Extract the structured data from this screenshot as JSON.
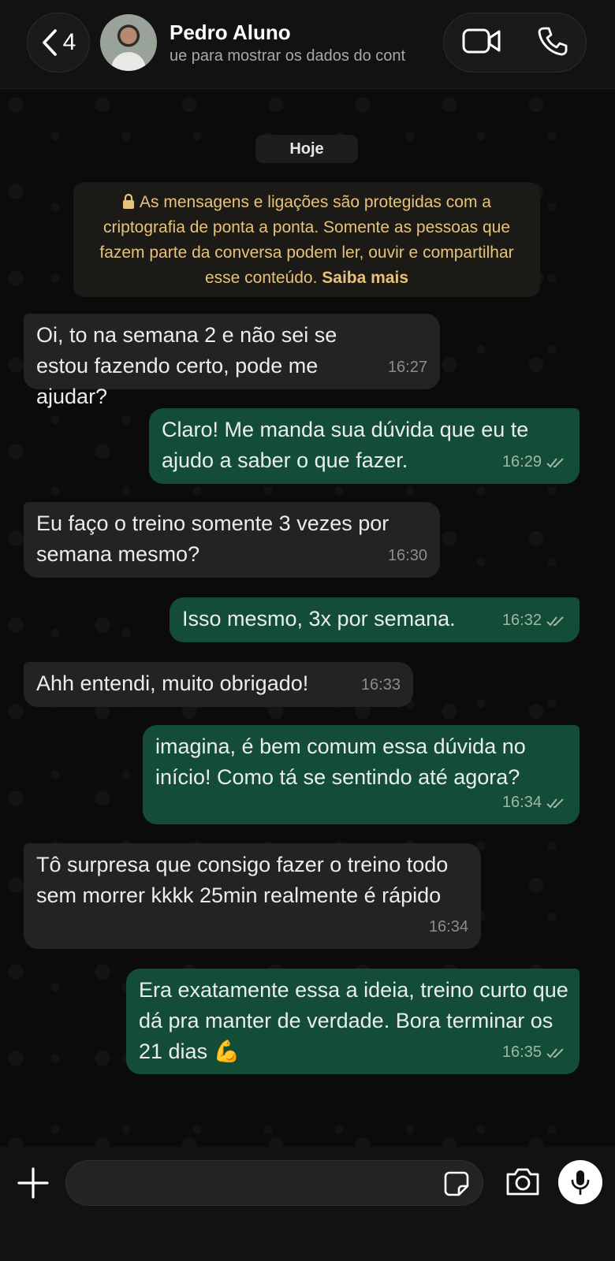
{
  "header": {
    "back_count": "4",
    "contact_name": "Pedro Aluno",
    "contact_subtitle": "ue para mostrar os dados do cont",
    "icons": {
      "back": "chevron-left-icon",
      "video": "video-camera-icon",
      "call": "phone-icon"
    }
  },
  "chat": {
    "day_label": "Hoje",
    "encryption_notice": "As mensagens e ligações são protegidas com a criptografia de ponta a ponta. Somente as pessoas que fazem parte da conversa podem ler, ouvir e compartilhar esse conteúdo.",
    "encryption_link": "Saiba mais",
    "messages": [
      {
        "direction": "in",
        "text": "Oi, to na semana 2 e não sei se estou fazendo certo, pode me ajudar?",
        "time": "16:27"
      },
      {
        "direction": "out",
        "text": "Claro! Me manda sua dúvida que eu te ajudo a saber o que fazer.",
        "time": "16:29",
        "status": "read"
      },
      {
        "direction": "in",
        "text": "Eu faço o treino somente 3 vezes por semana mesmo?",
        "time": "16:30"
      },
      {
        "direction": "out",
        "text": "Isso mesmo, 3x por semana.",
        "time": "16:32",
        "status": "read"
      },
      {
        "direction": "in",
        "text": "Ahh entendi, muito obrigado!",
        "time": "16:33"
      },
      {
        "direction": "out",
        "text": "imagina, é bem comum essa dúvida no início! Como tá se sentindo até agora?",
        "time": "16:34",
        "status": "read"
      },
      {
        "direction": "in",
        "text": "Tô surpresa que consigo fazer o treino todo sem morrer kkkk 25min realmente é rápido",
        "time": "16:34"
      },
      {
        "direction": "out",
        "text": "Era exatamente essa a ideia, treino curto que dá pra manter de verdade. Bora terminar os 21 dias 💪",
        "time": "16:35",
        "status": "read"
      }
    ]
  },
  "composer": {
    "input_value": "",
    "icons": {
      "add": "plus-icon",
      "sticker": "sticker-icon",
      "camera": "camera-icon",
      "mic": "microphone-icon"
    }
  },
  "colors": {
    "background": "#0b0b0b",
    "incoming_bubble": "#232323",
    "outgoing_bubble": "#134d37",
    "notice_text": "#e7c27a"
  }
}
